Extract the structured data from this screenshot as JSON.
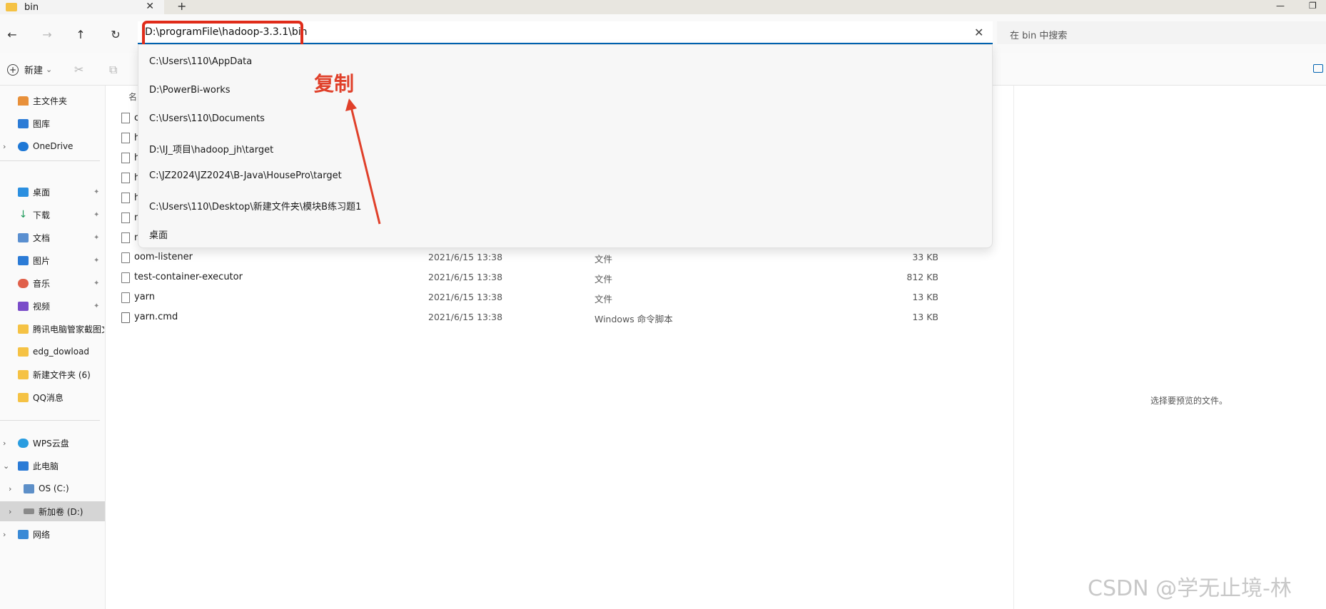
{
  "tab": {
    "title": "bin",
    "close": "✕",
    "new": "+"
  },
  "window": {
    "minimize": "—",
    "restore": "❐"
  },
  "nav": {
    "back": "←",
    "forward": "→",
    "up": "↑",
    "refresh": "↻"
  },
  "address": {
    "value": "D:\\programFile\\hadoop-3.3.1\\bin",
    "clear": "✕"
  },
  "search": {
    "placeholder": "在 bin 中搜索"
  },
  "toolbar": {
    "new_label": "新建",
    "new_chevron": "⌄",
    "cut": "✂",
    "copy": "⧉"
  },
  "dropdown": {
    "items": [
      "C:\\Users\\110\\AppData",
      "D:\\PowerBi-works",
      "C:\\Users\\110\\Documents",
      "D:\\IJ_项目\\hadoop_jh\\target",
      "C:\\JZ2024\\JZ2024\\B-Java\\HousePro\\target",
      "C:\\Users\\110\\Desktop\\新建文件夹\\模块B练习题1",
      "桌面"
    ]
  },
  "annotation": {
    "text": "复制",
    "color": "#e0402a"
  },
  "sidebar": {
    "items": [
      {
        "label": "主文件夹",
        "icon": "home-icon"
      },
      {
        "label": "图库",
        "icon": "gallery-icon"
      },
      {
        "label": "OneDrive",
        "icon": "cloud-icon",
        "chevron": "›"
      },
      {
        "label": "桌面",
        "icon": "desktop-icon",
        "pin": "📌"
      },
      {
        "label": "下载",
        "icon": "download-icon",
        "pin": "📌"
      },
      {
        "label": "文档",
        "icon": "document-icon",
        "pin": "📌"
      },
      {
        "label": "图片",
        "icon": "picture-icon",
        "pin": "📌"
      },
      {
        "label": "音乐",
        "icon": "music-icon",
        "pin": "📌"
      },
      {
        "label": "视频",
        "icon": "video-icon",
        "pin": "📌"
      },
      {
        "label": "腾讯电脑管家截图文件",
        "icon": "folder-icon"
      },
      {
        "label": "edg_dowload",
        "icon": "folder-icon"
      },
      {
        "label": "新建文件夹 (6)",
        "icon": "folder-icon"
      },
      {
        "label": "QQ消息",
        "icon": "folder-icon"
      },
      {
        "label": "WPS云盘",
        "icon": "cloud-icon",
        "chevron": "›"
      },
      {
        "label": "此电脑",
        "icon": "pc-icon",
        "chevron": "⌄"
      },
      {
        "label": "OS (C:)",
        "icon": "drive-icon",
        "chevron": "›"
      },
      {
        "label": "新加卷 (D:)",
        "icon": "drive-icon",
        "chevron": "›"
      },
      {
        "label": "网络",
        "icon": "network-icon",
        "chevron": "›"
      }
    ]
  },
  "filelist": {
    "header_name": "名",
    "rows": [
      {
        "name": "oom-listener",
        "date": "2021/6/15 13:38",
        "type": "文件",
        "size": "33 KB"
      },
      {
        "name": "test-container-executor",
        "date": "2021/6/15 13:38",
        "type": "文件",
        "size": "812 KB"
      },
      {
        "name": "yarn",
        "date": "2021/6/15 13:38",
        "type": "文件",
        "size": "13 KB"
      },
      {
        "name": "yarn.cmd",
        "date": "2021/6/15 13:38",
        "type": "Windows 命令脚本",
        "size": "13 KB"
      }
    ],
    "partial_letters": [
      "c",
      "h",
      "h",
      "h",
      "h",
      "m",
      "m"
    ]
  },
  "preview": {
    "text": "选择要预览的文件。"
  },
  "watermark": {
    "text": "CSDN @学无止境-林"
  }
}
